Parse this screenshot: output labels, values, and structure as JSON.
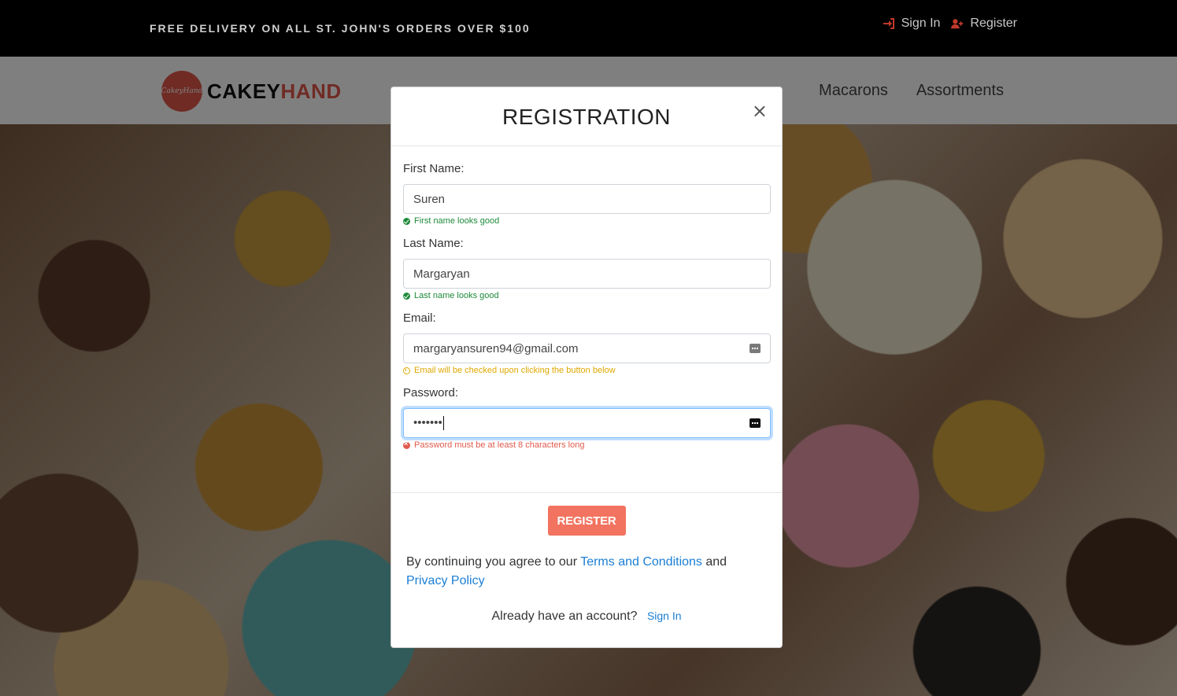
{
  "topbar": {
    "promo": "FREE DELIVERY ON ALL ST. JOHN'S ORDERS OVER $100",
    "sign_in": "Sign In",
    "register": "Register"
  },
  "logo": {
    "badge": "CakeyHand",
    "part1": "CAKEY",
    "part2": "HAND"
  },
  "nav": {
    "items": [
      "Macarons",
      "Assortments"
    ]
  },
  "modal": {
    "title": "REGISTRATION",
    "close": "×",
    "fields": {
      "first_name": {
        "label": "First Name:",
        "value": "Suren",
        "feedback": "First name looks good"
      },
      "last_name": {
        "label": "Last Name:",
        "value": "Margaryan",
        "feedback": "Last name looks good"
      },
      "email": {
        "label": "Email:",
        "value": "margaryansuren94@gmail.com",
        "feedback": "Email will be checked upon clicking the button below"
      },
      "password": {
        "label": "Password:",
        "value": "•••••••",
        "feedback": "Password must be at least 8 characters long"
      }
    },
    "register_button": "REGISTER",
    "terms_prefix": "By continuing you agree to our ",
    "terms_link": "Terms and Conditions",
    "terms_and": " and",
    "privacy_link": "Privacy Policy",
    "already": "Already have an account?",
    "signin_link": "Sign In"
  },
  "colors": {
    "accent": "#f2735f",
    "link": "#1a7fd4",
    "success": "#1e8a3a",
    "warning": "#e0a800",
    "error": "#e05a4c"
  }
}
